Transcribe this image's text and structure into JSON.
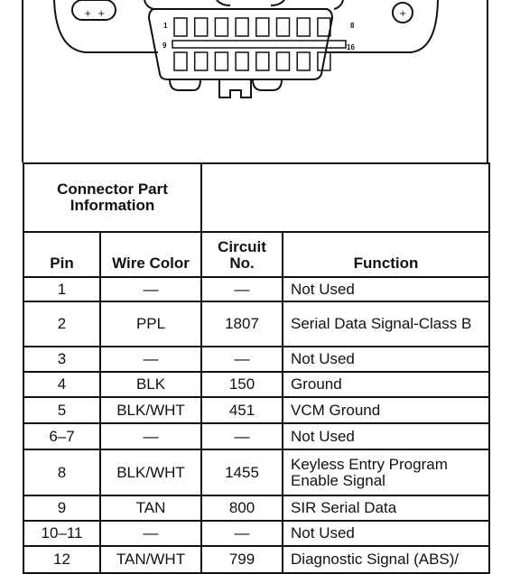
{
  "diagram": {
    "pin_labels": {
      "top_left": "1",
      "top_right": "8",
      "bottom_left": "9",
      "bottom_right": "16"
    }
  },
  "table": {
    "part_info_header": "Connector Part Information",
    "columns": [
      "Pin",
      "Wire Color",
      "Circuit No.",
      "Function"
    ],
    "rows": [
      {
        "pin": "1",
        "wire": "—",
        "circuit": "—",
        "function": "Not Used"
      },
      {
        "pin": "2",
        "wire": "PPL",
        "circuit": "1807",
        "function": "Serial Data Signal-Class B"
      },
      {
        "pin": "3",
        "wire": "—",
        "circuit": "—",
        "function": "Not Used"
      },
      {
        "pin": "4",
        "wire": "BLK",
        "circuit": "150",
        "function": "Ground"
      },
      {
        "pin": "5",
        "wire": "BLK/WHT",
        "circuit": "451",
        "function": "VCM Ground"
      },
      {
        "pin": "6–7",
        "wire": "—",
        "circuit": "—",
        "function": "Not Used"
      },
      {
        "pin": "8",
        "wire": "BLK/WHT",
        "circuit": "1455",
        "function": "Keyless Entry Program Enable Signal"
      },
      {
        "pin": "9",
        "wire": "TAN",
        "circuit": "800",
        "function": "SIR Serial Data"
      },
      {
        "pin": "10–11",
        "wire": "—",
        "circuit": "—",
        "function": "Not Used"
      },
      {
        "pin": "12",
        "wire": "TAN/WHT",
        "circuit": "799",
        "function": "Diagnostic Signal (ABS)/"
      }
    ]
  }
}
